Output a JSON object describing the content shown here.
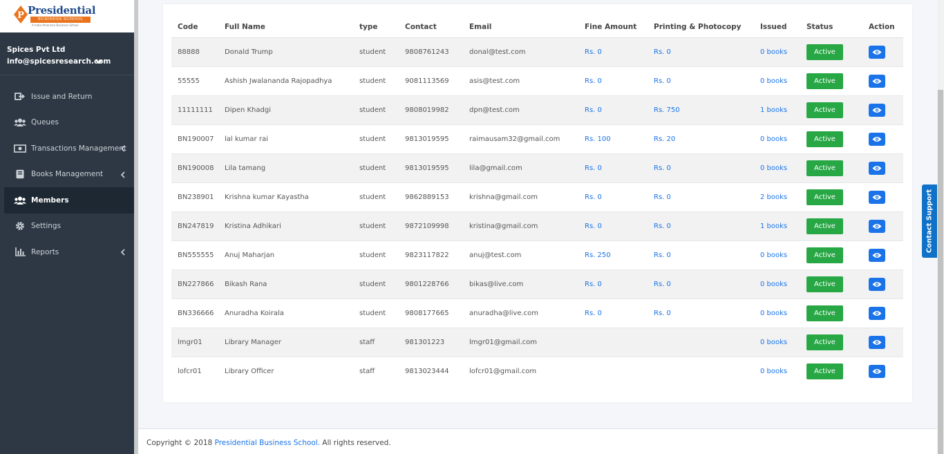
{
  "brand": {
    "logo_letter": "P",
    "name": "Presidential",
    "sub": "BUSINESS SCHOOL",
    "tagline": "A India American Business School",
    "accent_color": "#e9741d",
    "primary_color": "#1f4a8c"
  },
  "user": {
    "org": "Spices Pvt Ltd",
    "email": "info@spicesresearch.com",
    "caret_icon": "chevron-down-icon"
  },
  "nav": {
    "items": [
      {
        "label": "Issue and Return",
        "icon": "exchange-icon"
      },
      {
        "label": "Queues",
        "icon": "users-icon"
      },
      {
        "label": "Transactions Management",
        "icon": "money-icon"
      },
      {
        "label": "Books Management",
        "icon": "book-icon"
      },
      {
        "label": "Members",
        "icon": "users-icon"
      },
      {
        "label": "Settings",
        "icon": "gear-icon"
      },
      {
        "label": "Reports",
        "icon": "bar-chart-icon"
      }
    ]
  },
  "table": {
    "headers": {
      "code": "Code",
      "full_name": "Full Name",
      "type": "type",
      "contact": "Contact",
      "email": "Email",
      "fine_amount": "Fine Amount",
      "printing": "Printing & Photocopy",
      "issued": "Issued",
      "status": "Status",
      "action": "Action"
    },
    "rows": [
      {
        "code": "88888",
        "name": "Donald Trump",
        "type": "student",
        "contact": "9808761243",
        "email": "donal@test.com",
        "fine": "Rs. 0",
        "printing": "Rs. 0",
        "issued": "0 books",
        "status": "Active"
      },
      {
        "code": "55555",
        "name": "Ashish Jwalananda Rajopadhya",
        "type": "student",
        "contact": "9081113569",
        "email": "asis@test.com",
        "fine": "Rs. 0",
        "printing": "Rs. 0",
        "issued": "0 books",
        "status": "Active"
      },
      {
        "code": "11111111",
        "name": "Dipen Khadgi",
        "type": "student",
        "contact": "9808019982",
        "email": "dpn@test.com",
        "fine": "Rs. 0",
        "printing": "Rs. 750",
        "issued": "1 books",
        "status": "Active"
      },
      {
        "code": "BN190007",
        "name": "lal kumar rai",
        "type": "student",
        "contact": "9813019595",
        "email": "raimausam32@gmail.com",
        "fine": "Rs. 100",
        "printing": "Rs. 20",
        "issued": "0 books",
        "status": "Active"
      },
      {
        "code": "BN190008",
        "name": "Lila tamang",
        "type": "student",
        "contact": "9813019595",
        "email": "lila@gmail.com",
        "fine": "Rs. 0",
        "printing": "Rs. 0",
        "issued": "0 books",
        "status": "Active"
      },
      {
        "code": "BN238901",
        "name": "Krishna kumar Kayastha",
        "type": "student",
        "contact": "9862889153",
        "email": "krishna@gmail.com",
        "fine": "Rs. 0",
        "printing": "Rs. 0",
        "issued": "2 books",
        "status": "Active"
      },
      {
        "code": "BN247819",
        "name": "Kristina Adhikari",
        "type": "student",
        "contact": "9872109998",
        "email": "kristina@gmail.com",
        "fine": "Rs. 0",
        "printing": "Rs. 0",
        "issued": "1 books",
        "status": "Active"
      },
      {
        "code": "BN555555",
        "name": "Anuj Maharjan",
        "type": "student",
        "contact": "9823117822",
        "email": "anuj@test.com",
        "fine": "Rs. 250",
        "printing": "Rs. 0",
        "issued": "0 books",
        "status": "Active"
      },
      {
        "code": "BN227866",
        "name": "Bikash Rana",
        "type": "student",
        "contact": "9801228766",
        "email": "bikas@live.com",
        "fine": "Rs. 0",
        "printing": "Rs. 0",
        "issued": "0 books",
        "status": "Active"
      },
      {
        "code": "BN336666",
        "name": "Anuradha Koirala",
        "type": "student",
        "contact": "9808177665",
        "email": "anuradha@live.com",
        "fine": "Rs. 0",
        "printing": "Rs. 0",
        "issued": "0 books",
        "status": "Active"
      },
      {
        "code": "lmgr01",
        "name": "Library Manager",
        "type": "staff",
        "contact": "981301223",
        "email": "lmgr01@gmail.com",
        "fine": "",
        "printing": "",
        "issued": "0 books",
        "status": "Active"
      },
      {
        "code": "lofcr01",
        "name": "Library Officer",
        "type": "staff",
        "contact": "9813023444",
        "email": "lofcr01@gmail.com",
        "fine": "",
        "printing": "",
        "issued": "0 books",
        "status": "Active"
      }
    ]
  },
  "footer": {
    "prefix": "Copyright © 2018 ",
    "brand": "Presidential Business School.",
    "suffix": " All rights reserved."
  },
  "contact_support": "Contact Support",
  "colors": {
    "sidebar_bg": "#2d3844",
    "active_status": "#28a745",
    "link": "#1a73e8"
  }
}
